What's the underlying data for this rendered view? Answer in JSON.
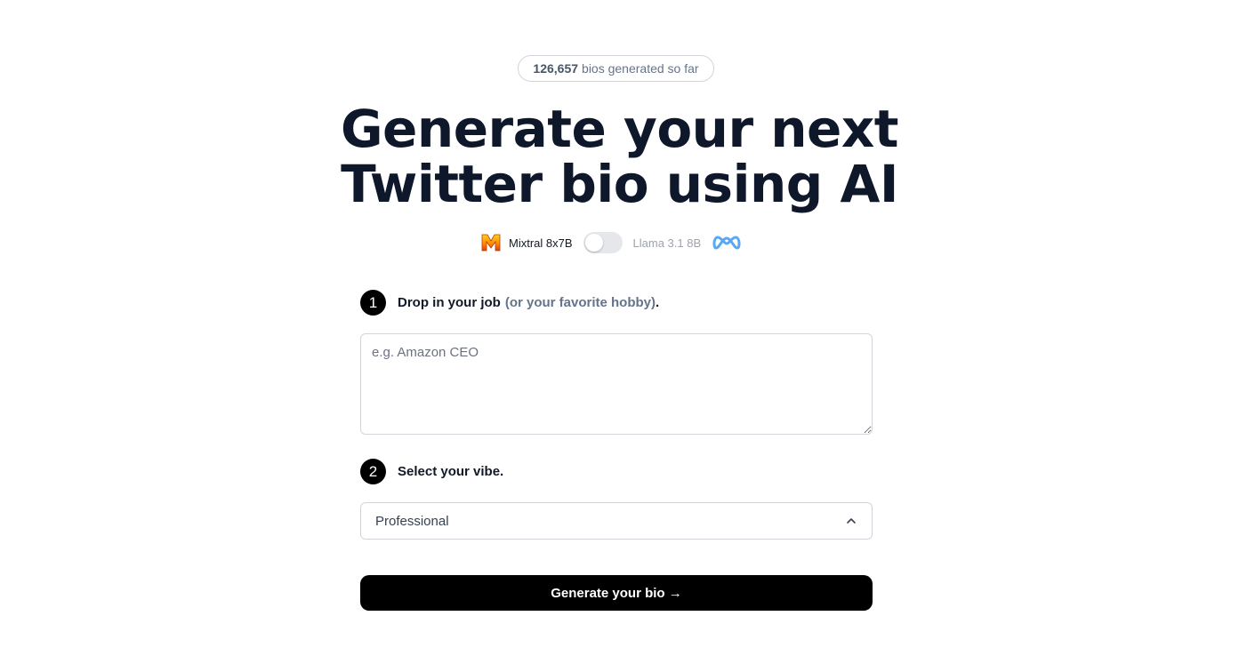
{
  "counter": {
    "count": "126,657",
    "suffix": "bios generated so far"
  },
  "headline": {
    "line1": "Generate your next",
    "line2": "Twitter bio using AI"
  },
  "model_toggle": {
    "left_label": "Mixtral 8x7B",
    "right_label": "Llama 3.1 8B",
    "left_icon": "mixtral-logo-icon",
    "right_icon": "meta-logo-icon",
    "state": "left"
  },
  "step1": {
    "number": "1",
    "label": "Drop in your job",
    "hint": "(or your favorite hobby)",
    "end": "."
  },
  "job_input": {
    "placeholder": "e.g. Amazon CEO",
    "value": ""
  },
  "step2": {
    "number": "2",
    "label": "Select your vibe."
  },
  "vibe_select": {
    "value": "Professional",
    "icon": "chevron-up-icon"
  },
  "generate_button": {
    "label": "Generate your bio →"
  },
  "colors": {
    "text": "#0f172a",
    "muted": "#64748b",
    "button_bg": "#000000",
    "border": "#d1d5db",
    "meta_blue": "#0081fb"
  }
}
